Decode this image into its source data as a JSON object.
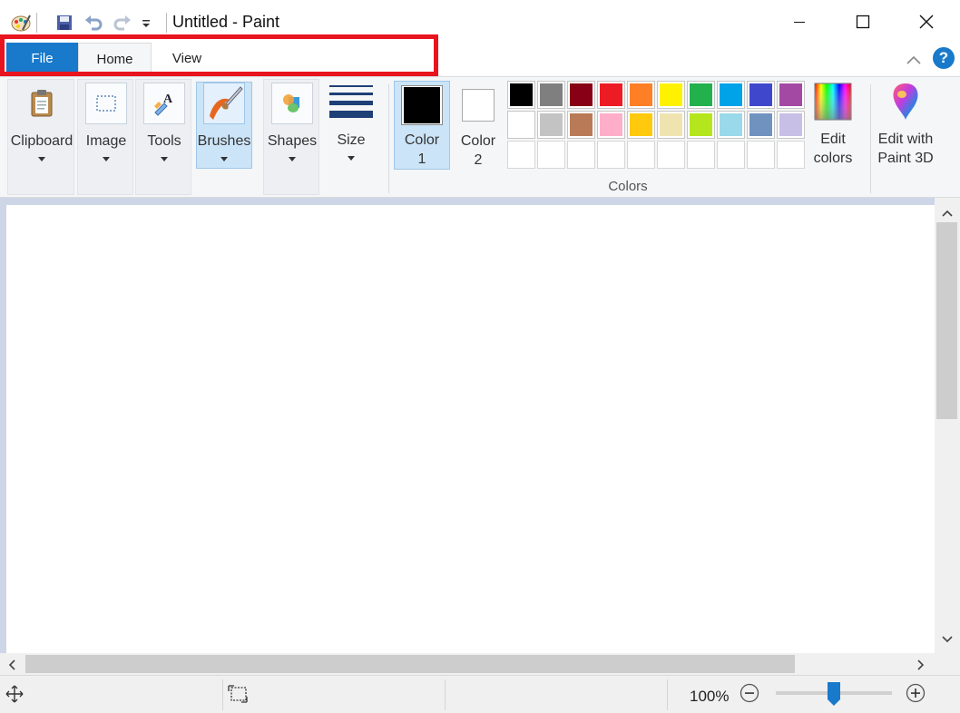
{
  "window": {
    "title": "Untitled - Paint",
    "minimize_icon": "minimize-icon",
    "maximize_icon": "maximize-icon",
    "close_icon": "close-icon"
  },
  "quick_access": {
    "icons": [
      "paint-app-icon",
      "save-icon",
      "undo-icon",
      "redo-icon",
      "customize-dropdown-icon"
    ]
  },
  "tabs": [
    {
      "label": "File"
    },
    {
      "label": "Home"
    },
    {
      "label": "View"
    }
  ],
  "ribbon": {
    "groups": [
      {
        "label": "Clipboard",
        "icon": "clipboard-icon"
      },
      {
        "label": "Image",
        "icon": "select-icon"
      },
      {
        "label": "Tools",
        "icon": "tools-icon"
      },
      {
        "label": "Brushes",
        "icon": "brush-icon"
      },
      {
        "label": "Shapes",
        "icon": "shapes-icon"
      },
      {
        "label": "Size",
        "icon": "line-size-icon"
      }
    ],
    "color1": {
      "label": "Color",
      "sub": "1",
      "value": "#000000"
    },
    "color2": {
      "label": "Color",
      "sub": "2",
      "value": "#ffffff"
    },
    "colors_group_label": "Colors",
    "palette": [
      [
        "#000000",
        "#7f7f7f",
        "#880015",
        "#ed1c24",
        "#ff7f27",
        "#fff200",
        "#22b14c",
        "#00a2e8",
        "#3f48cc",
        "#a349a4"
      ],
      [
        "#ffffff",
        "#c3c3c3",
        "#b97a57",
        "#ffaec9",
        "#ffc90e",
        "#efe4b0",
        "#b5e61d",
        "#99d9ea",
        "#7092be",
        "#c8bfe7"
      ],
      [
        "",
        "",
        "",
        "",
        "",
        "",
        "",
        "",
        "",
        ""
      ]
    ],
    "edit_colors": {
      "line1": "Edit",
      "line2": "colors"
    },
    "edit_paint3d": {
      "line1": "Edit with",
      "line2": "Paint 3D"
    }
  },
  "status": {
    "zoom": "100%",
    "zoom_fraction": 0.5
  },
  "colors": {
    "accent": "#1979ca",
    "highlight": "#e8141e"
  }
}
